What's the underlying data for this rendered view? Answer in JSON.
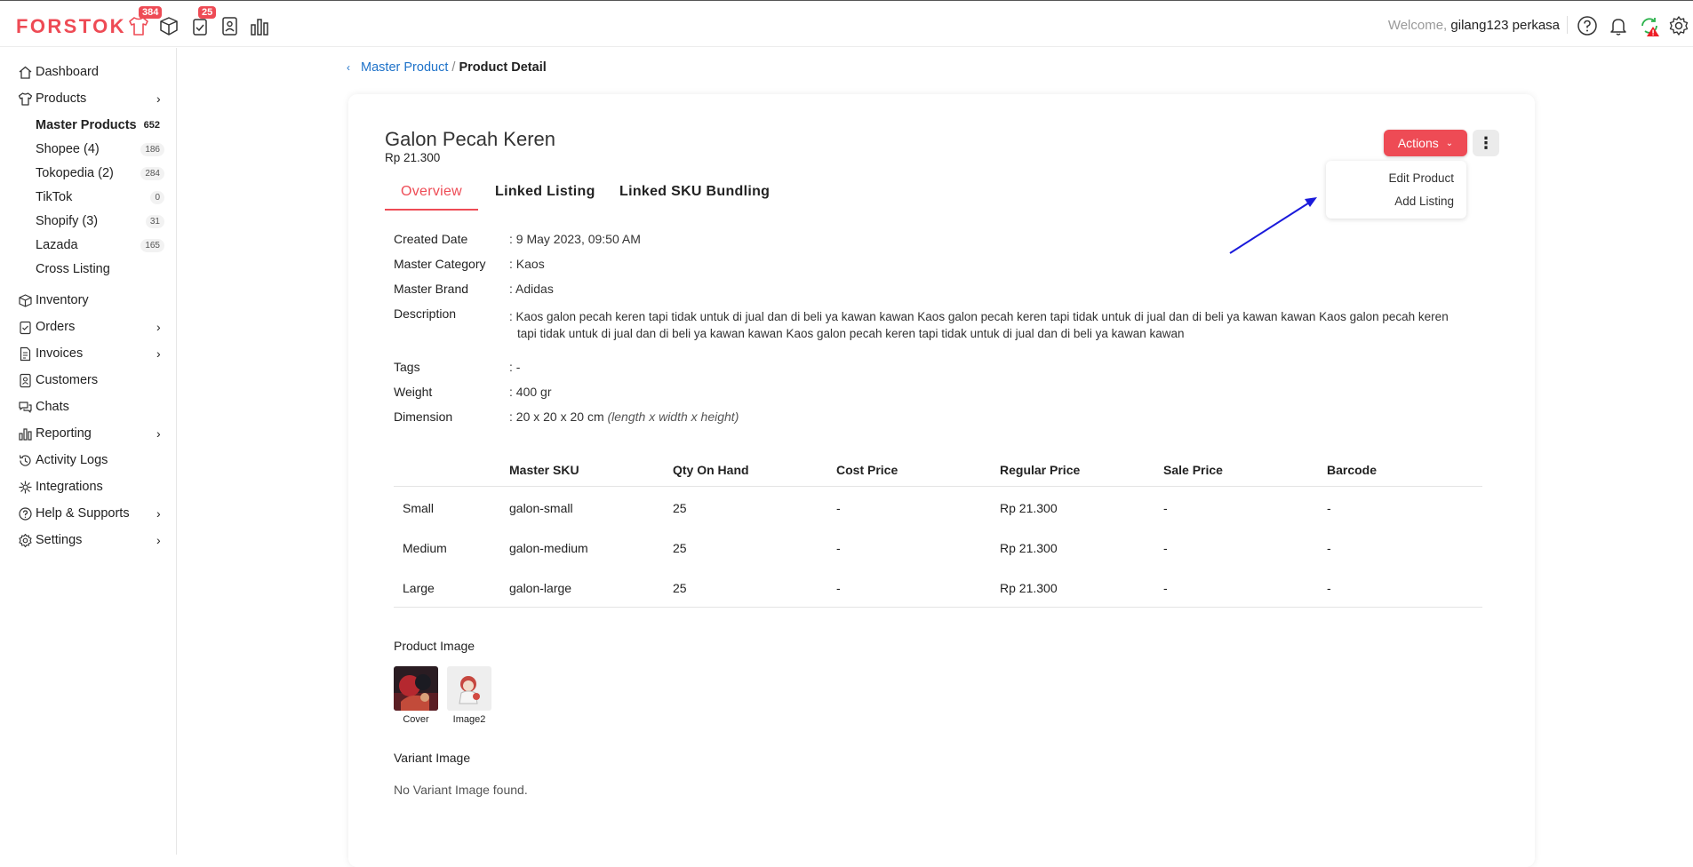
{
  "brand": "FORSTOK",
  "topbar": {
    "badges": {
      "products": "384",
      "tasks": "25"
    },
    "welcome_prefix": "Welcome,",
    "username": "gilang123 perkasa"
  },
  "sidebar": {
    "items": [
      {
        "label": "Dashboard"
      },
      {
        "label": "Products"
      },
      {
        "label": "Inventory"
      },
      {
        "label": "Orders"
      },
      {
        "label": "Invoices"
      },
      {
        "label": "Customers"
      },
      {
        "label": "Chats"
      },
      {
        "label": "Reporting"
      },
      {
        "label": "Activity Logs"
      },
      {
        "label": "Integrations"
      },
      {
        "label": "Help & Supports"
      },
      {
        "label": "Settings"
      }
    ],
    "products_sub": [
      {
        "label": "Master Products",
        "count": "652"
      },
      {
        "label": "Shopee (4)",
        "count": "186"
      },
      {
        "label": "Tokopedia (2)",
        "count": "284"
      },
      {
        "label": "TikTok",
        "count": "0"
      },
      {
        "label": "Shopify (3)",
        "count": "31"
      },
      {
        "label": "Lazada",
        "count": "165"
      },
      {
        "label": "Cross Listing",
        "count": ""
      }
    ]
  },
  "breadcrumb": {
    "parent": "Master Product",
    "separator": "/",
    "current": "Product Detail"
  },
  "product": {
    "name": "Galon Pecah Keren",
    "price": "Rp 21.300"
  },
  "actions": {
    "label": "Actions",
    "menu": [
      "Edit Product",
      "Add Listing"
    ]
  },
  "tabs": [
    "Overview",
    "Linked Listing",
    "Linked SKU Bundling"
  ],
  "details": {
    "created_label": "Created Date",
    "created_value": ": 9 May 2023, 09:50 AM",
    "category_label": "Master Category",
    "category_value": ": Kaos",
    "brand_label": "Master Brand",
    "brand_value": ": Adidas",
    "description_label": "Description",
    "description_value": ": Kaos galon pecah keren tapi tidak untuk di jual dan di beli ya kawan kawan Kaos galon pecah keren tapi tidak untuk di jual dan di beli ya kawan kawan Kaos galon pecah keren tapi tidak untuk di jual dan di beli ya kawan kawan Kaos galon pecah keren tapi tidak untuk di jual dan di beli ya kawan kawan",
    "tags_label": "Tags",
    "tags_value": ": -",
    "weight_label": "Weight",
    "weight_value": ": 400 gr",
    "dimension_label": "Dimension",
    "dimension_value": ": 20 x 20 x 20 cm",
    "dimension_note": "(length x width x height)"
  },
  "variants": {
    "columns": [
      "Master SKU",
      "Qty On Hand",
      "Cost Price",
      "Regular Price",
      "Sale Price",
      "Barcode"
    ],
    "rows": [
      {
        "name": "Small",
        "sku": "galon-small",
        "qty": "25",
        "cost": "-",
        "regular": "Rp 21.300",
        "sale": "-",
        "barcode": "-"
      },
      {
        "name": "Medium",
        "sku": "galon-medium",
        "qty": "25",
        "cost": "-",
        "regular": "Rp 21.300",
        "sale": "-",
        "barcode": "-"
      },
      {
        "name": "Large",
        "sku": "galon-large",
        "qty": "25",
        "cost": "-",
        "regular": "Rp 21.300",
        "sale": "-",
        "barcode": "-"
      }
    ]
  },
  "product_image": {
    "label": "Product Image",
    "captions": [
      "Cover",
      "Image2"
    ]
  },
  "variant_image": {
    "label": "Variant Image",
    "empty": "No Variant Image found."
  },
  "colors": {
    "accent": "#ee4b55",
    "link": "#1e72c9",
    "annotation_arrow": "#1a1adb"
  }
}
